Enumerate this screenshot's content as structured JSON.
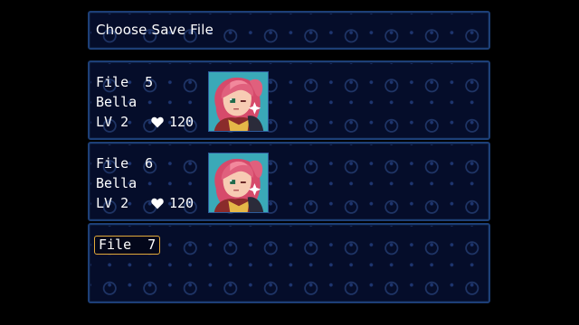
{
  "screen": {
    "title": "Choose Save File",
    "accent_color": "#e3a93a",
    "panel_border_color": "#1d3f77"
  },
  "save_slots": [
    {
      "file_label": "File  5",
      "character_name": "Bella",
      "level": "LV 2",
      "hp": "120",
      "hp_icon": "heart-icon",
      "portrait": "bella-portrait"
    },
    {
      "file_label": "File  6",
      "character_name": "Bella",
      "level": "LV 2",
      "hp": "120",
      "hp_icon": "heart-icon",
      "portrait": "bella-portrait"
    },
    {
      "file_label": "File  7",
      "selected": true
    }
  ]
}
